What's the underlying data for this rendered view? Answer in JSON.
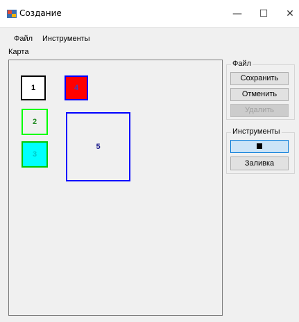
{
  "window": {
    "title": "Создание",
    "minimize": "—",
    "maximize": "☐",
    "close": "✕"
  },
  "menu": {
    "file": "Файл",
    "tools": "Инструменты"
  },
  "map_label": "Карта",
  "shapes": [
    {
      "label": "1",
      "fill": "#ffffff",
      "border": "#000000",
      "text_color": "#000000"
    },
    {
      "label": "2",
      "fill": "#f0f0f0",
      "border": "#00ff00",
      "text_color": "#228b22"
    },
    {
      "label": "3",
      "fill": "#00ffff",
      "border": "#00c800",
      "text_color": "#00c8c8"
    },
    {
      "label": "4",
      "fill": "#ff0000",
      "border": "#0000ff",
      "text_color": "#4040c0"
    },
    {
      "label": "5",
      "fill": "#f0f0f0",
      "border": "#0000ff",
      "text_color": "#1c1c8c"
    }
  ],
  "file_group": {
    "title": "Файл",
    "save": "Сохранить",
    "cancel": "Отменить",
    "delete": "Удалить"
  },
  "tools_group": {
    "title": "Инструменты",
    "fill": "Заливка",
    "selected_color": "#000000"
  }
}
